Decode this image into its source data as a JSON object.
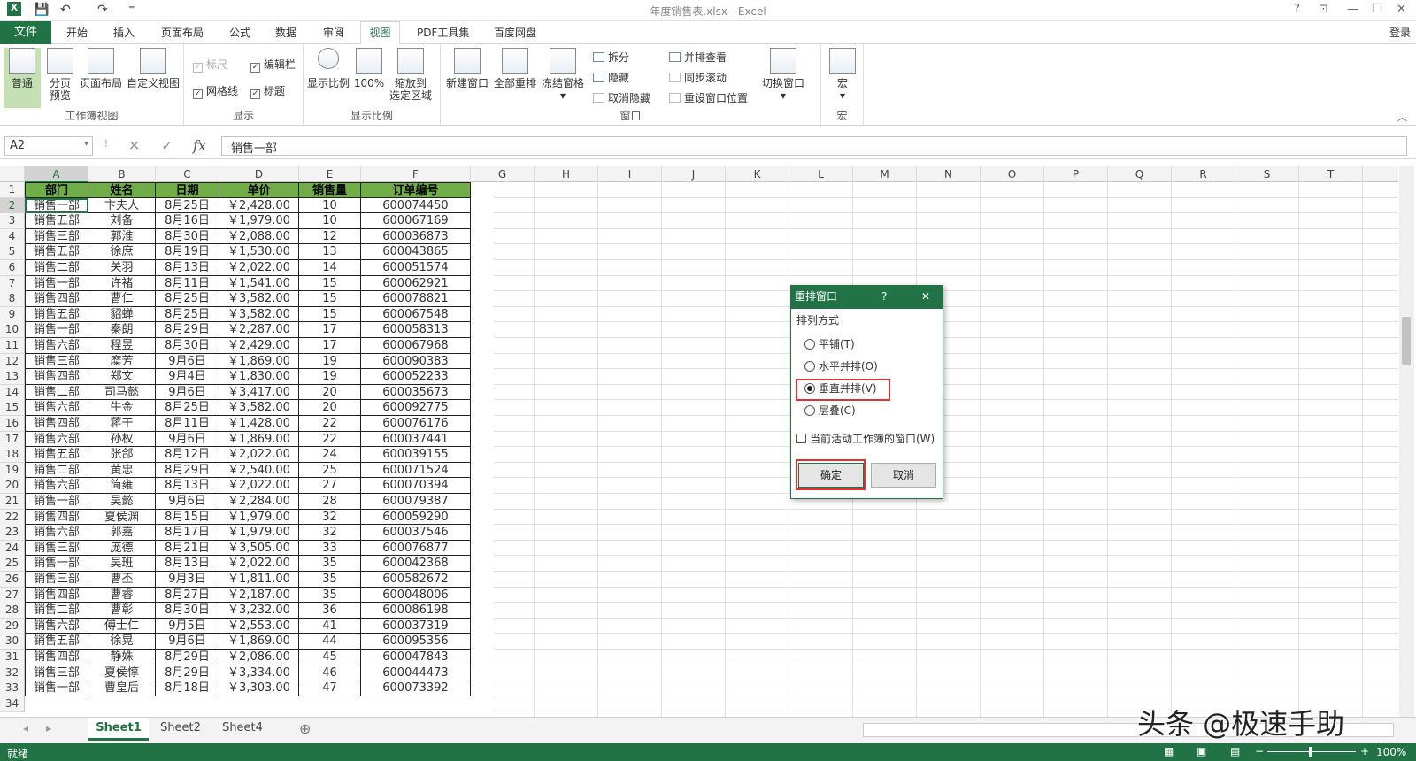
{
  "window": {
    "title": "年度销售表.xlsx - Excel",
    "help": "?",
    "min": "—",
    "restore": "❐",
    "close": "✕"
  },
  "quick": {
    "save": "💾",
    "undo": "↶",
    "redo": "↷",
    "more": "⁼"
  },
  "tabs": [
    "开始",
    "插入",
    "页面布局",
    "公式",
    "数据",
    "审阅",
    "视图",
    "PDF工具集",
    "百度网盘"
  ],
  "file_tab": "文件",
  "login": "登录",
  "ribbon": {
    "workbook_views": {
      "label": "工作簿视图",
      "normal": "普通",
      "pagebreak1": "分页",
      "pagebreak2": "预览",
      "pagelayout": "页面布局",
      "custom": "自定义视图"
    },
    "show": {
      "label": "显示",
      "ruler": "标尺",
      "formulabar": "编辑栏",
      "gridlines": "网格线",
      "headings": "标题"
    },
    "zoom": {
      "label": "显示比例",
      "zoom": "显示比例",
      "hundred": "100%",
      "selection1": "缩放到",
      "selection2": "选定区域"
    },
    "window": {
      "label": "窗口",
      "new": "新建窗口",
      "arrange": "全部重排",
      "freeze": "冻结窗格",
      "split": "拆分",
      "hide": "隐藏",
      "unhide": "取消隐藏",
      "side": "并排查看",
      "sync": "同步滚动",
      "reset": "重设窗口位置",
      "switch": "切换窗口"
    },
    "macros": {
      "label": "宏",
      "macro": "宏"
    }
  },
  "formula": {
    "namebox": "A2",
    "value": "销售一部",
    "fx": "fx",
    "cancel": "✕",
    "enter": "✓"
  },
  "columns": [
    "A",
    "B",
    "C",
    "D",
    "E",
    "F",
    "G",
    "H",
    "I",
    "J",
    "K",
    "L",
    "M",
    "N",
    "O",
    "P",
    "Q",
    "R",
    "S",
    "T"
  ],
  "headers": [
    "部门",
    "姓名",
    "日期",
    "单价",
    "销售量",
    "订单编号"
  ],
  "rows": [
    [
      "销售一部",
      "卞夫人",
      "8月25日",
      "￥2,428.00",
      "10",
      "600074450"
    ],
    [
      "销售五部",
      "刘备",
      "8月16日",
      "￥1,979.00",
      "10",
      "600067169"
    ],
    [
      "销售三部",
      "郭淮",
      "8月30日",
      "￥2,088.00",
      "12",
      "600036873"
    ],
    [
      "销售五部",
      "徐庶",
      "8月19日",
      "￥1,530.00",
      "13",
      "600043865"
    ],
    [
      "销售二部",
      "关羽",
      "8月13日",
      "￥2,022.00",
      "14",
      "600051574"
    ],
    [
      "销售一部",
      "许褚",
      "8月11日",
      "￥1,541.00",
      "15",
      "600062921"
    ],
    [
      "销售四部",
      "曹仁",
      "8月25日",
      "￥3,582.00",
      "15",
      "600078821"
    ],
    [
      "销售五部",
      "貂蝉",
      "8月25日",
      "￥3,582.00",
      "15",
      "600067548"
    ],
    [
      "销售一部",
      "秦朗",
      "8月29日",
      "￥2,287.00",
      "17",
      "600058313"
    ],
    [
      "销售六部",
      "程昱",
      "8月30日",
      "￥2,429.00",
      "17",
      "600067968"
    ],
    [
      "销售三部",
      "糜芳",
      "9月6日",
      "￥1,869.00",
      "19",
      "600090383"
    ],
    [
      "销售四部",
      "郑文",
      "9月4日",
      "￥1,830.00",
      "19",
      "600052233"
    ],
    [
      "销售二部",
      "司马懿",
      "9月6日",
      "￥3,417.00",
      "20",
      "600035673"
    ],
    [
      "销售六部",
      "牛金",
      "8月25日",
      "￥3,582.00",
      "20",
      "600092775"
    ],
    [
      "销售四部",
      "蒋干",
      "8月11日",
      "￥1,428.00",
      "22",
      "600076176"
    ],
    [
      "销售六部",
      "孙权",
      "9月6日",
      "￥1,869.00",
      "22",
      "600037441"
    ],
    [
      "销售五部",
      "张郃",
      "8月12日",
      "￥2,022.00",
      "24",
      "600039155"
    ],
    [
      "销售二部",
      "黄忠",
      "8月29日",
      "￥2,540.00",
      "25",
      "600071524"
    ],
    [
      "销售六部",
      "简雍",
      "8月13日",
      "￥2,022.00",
      "27",
      "600070394"
    ],
    [
      "销售一部",
      "吴懿",
      "9月6日",
      "￥2,284.00",
      "28",
      "600079387"
    ],
    [
      "销售四部",
      "夏侯渊",
      "8月15日",
      "￥1,979.00",
      "32",
      "600059290"
    ],
    [
      "销售六部",
      "郭嘉",
      "8月17日",
      "￥1,979.00",
      "32",
      "600037546"
    ],
    [
      "销售三部",
      "庞德",
      "8月21日",
      "￥3,505.00",
      "33",
      "600076877"
    ],
    [
      "销售一部",
      "吴班",
      "8月13日",
      "￥2,022.00",
      "35",
      "600042368"
    ],
    [
      "销售三部",
      "曹丕",
      "9月3日",
      "￥1,811.00",
      "35",
      "600582672"
    ],
    [
      "销售四部",
      "曹睿",
      "8月27日",
      "￥2,187.00",
      "35",
      "600048006"
    ],
    [
      "销售二部",
      "曹彰",
      "8月30日",
      "￥3,232.00",
      "36",
      "600086198"
    ],
    [
      "销售六部",
      "傅士仁",
      "9月5日",
      "￥2,553.00",
      "41",
      "600037319"
    ],
    [
      "销售五部",
      "徐晃",
      "9月6日",
      "￥1,869.00",
      "44",
      "600095356"
    ],
    [
      "销售四部",
      "静姝",
      "8月29日",
      "￥2,086.00",
      "45",
      "600047843"
    ],
    [
      "销售三部",
      "夏侯惇",
      "8月29日",
      "￥3,334.00",
      "46",
      "600044473"
    ],
    [
      "销售一部",
      "曹皇后",
      "8月18日",
      "￥3,303.00",
      "47",
      "600073392"
    ]
  ],
  "sheets": [
    "Sheet1",
    "Sheet2",
    "Sheet4"
  ],
  "add_sheet": "⊕",
  "status": {
    "ready": "就绪",
    "zoom": "100%",
    "minus": "−",
    "plus": "+"
  },
  "dialog": {
    "title": "重排窗口",
    "help": "?",
    "close": "✕",
    "group": "排列方式",
    "options": [
      "平铺(T)",
      "水平并排(O)",
      "垂直并排(V)",
      "层叠(C)"
    ],
    "selected": 2,
    "active_only": "当前活动工作簿的窗口(W)",
    "ok": "确定",
    "cancel": "取消"
  },
  "watermark": "头条 @极速手助",
  "colors": {
    "accent": "#217346",
    "header_fill": "#70ad47",
    "highlight": "#e03030"
  }
}
